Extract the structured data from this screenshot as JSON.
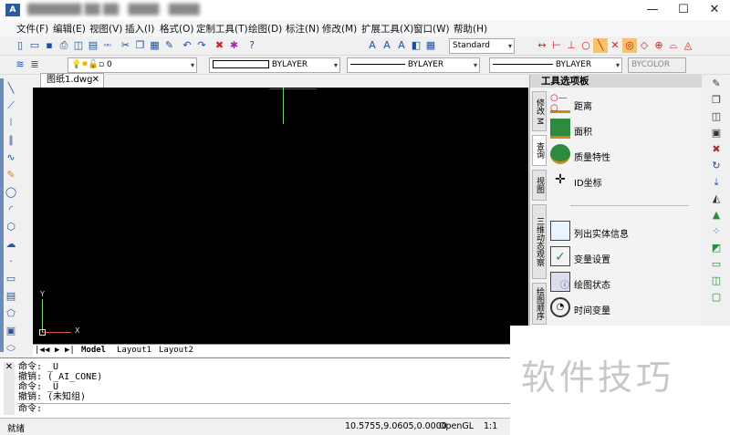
{
  "window": {
    "title": "███████ ██ ██ · ████ · ████",
    "minimize": "—",
    "maximize": "☐",
    "close": "✕"
  },
  "menu": [
    "文件(F)",
    "编辑(E)",
    "视图(V)",
    "插入(I)",
    "格式(O)",
    "定制工具(T)",
    "绘图(D)",
    "标注(N)",
    "修改(M)",
    "扩展工具(X)",
    "窗口(W)",
    "帮助(H)"
  ],
  "toolbar": {
    "text_style": "Standard",
    "layer": "0",
    "color": "BYLAYER",
    "linetype": "BYLAYER",
    "lineweight": "BYLAYER",
    "plotstyle": "BYCOLOR"
  },
  "drawing_tab": {
    "label": "图纸1.dwg",
    "close": "✕"
  },
  "ucs": {
    "x": "X",
    "y": "Y"
  },
  "layout_tabs": {
    "nav": [
      "|◀",
      "◀",
      "▶",
      "▶|"
    ],
    "tabs": [
      "Model",
      "Layout1",
      "Layout2"
    ]
  },
  "command": {
    "lines": [
      "命令: _U",
      "撤销: (_AI_CONE)",
      "命令: _U",
      "撤销: (未知组)",
      "命令:"
    ]
  },
  "status": {
    "left": "就绪",
    "coords": "10.5755,9.0605,0.0000",
    "renderer": "OpenGL",
    "scale": "1:1"
  },
  "palette": {
    "title": "工具选项板",
    "tabs": [
      "修改 M",
      "查询",
      "视图",
      "三维动态观察",
      "绘图顺序"
    ],
    "items": [
      "距离",
      "面积",
      "质量特性",
      "ID坐标",
      "列出实体信息",
      "变量设置",
      "绘图状态",
      "时间变量"
    ]
  },
  "watermark": "软件技巧"
}
